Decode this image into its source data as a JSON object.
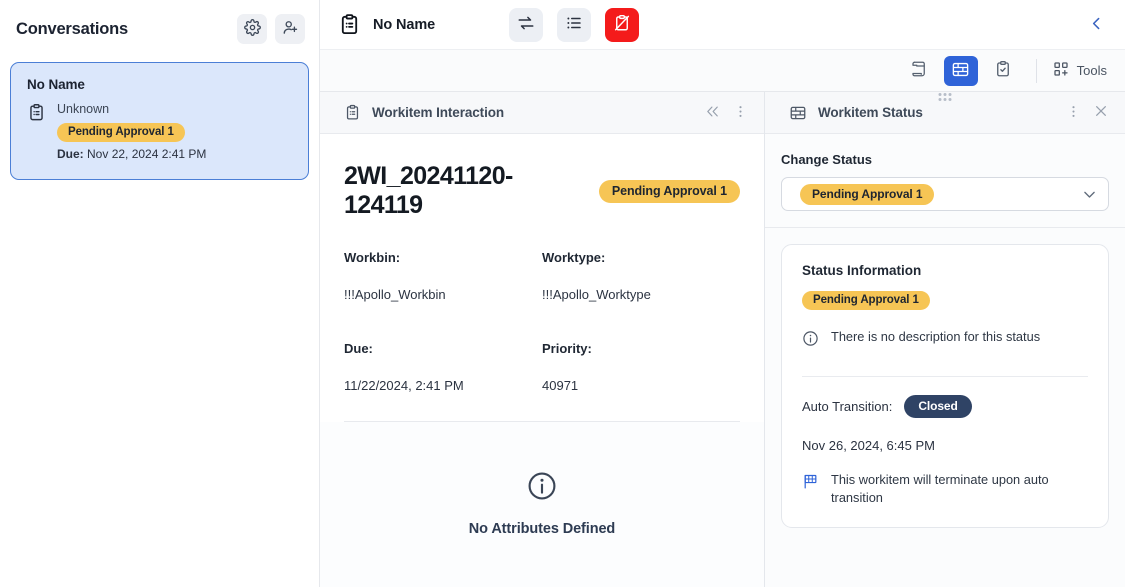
{
  "sidebar": {
    "title": "Conversations",
    "settings_icon": "gear-icon",
    "add_user_icon": "user-plus-icon",
    "conversation": {
      "name": "No Name",
      "channel_icon": "clipboard-list-icon",
      "channel": "Unknown",
      "status_badge": "Pending Approval 1",
      "due_label": "Due:",
      "due_value": "Nov 22, 2024 2:41 PM"
    }
  },
  "topbar": {
    "icon": "clipboard-list-icon",
    "title": "No Name",
    "transfer_icon": "transfer-arrows-icon",
    "list_icon": "list-bullets-icon",
    "cancel_icon": "clipboard-cancel-icon",
    "collapse_icon": "chevron-left-icon"
  },
  "toolsbar": {
    "scroll_icon": "scroll-icon",
    "wall_icon": "wall-brick-icon",
    "clipboard_check_icon": "clipboard-check-icon",
    "tools_icon": "grid-plus-icon",
    "tools_label": "Tools"
  },
  "main_pane": {
    "header_icon": "clipboard-list-icon",
    "header_title": "Workitem Interaction",
    "collapse_icon": "chevrons-left-icon",
    "menu_icon": "kebab-menu-icon",
    "workitem_id": "2WI_20241120-124119",
    "status_badge": "Pending Approval 1",
    "fields": [
      {
        "label": "Workbin:",
        "value": "!!!Apollo_Workbin"
      },
      {
        "label": "Worktype:",
        "value": "!!!Apollo_Worktype"
      },
      {
        "label": "Due:",
        "value": "11/22/2024, 2:41 PM"
      },
      {
        "label": "Priority:",
        "value": "40971"
      }
    ],
    "empty_icon": "info-circle-icon",
    "empty_text": "No Attributes Defined"
  },
  "status_pane": {
    "header_icon": "wall-brick-icon",
    "header_title": "Workitem Status",
    "menu_icon": "kebab-menu-icon",
    "close_icon": "close-x-icon",
    "change_status_label": "Change Status",
    "selected_status": "Pending Approval 1",
    "caret_icon": "chevron-down-icon",
    "card": {
      "title": "Status Information",
      "badge": "Pending Approval 1",
      "description_icon": "info-circle-icon",
      "description": "There is no description for this status",
      "auto_transition_label": "Auto Transition:",
      "auto_transition_value": "Closed",
      "auto_transition_date": "Nov 26, 2024, 6:45 PM",
      "terminate_icon": "flag-grid-icon",
      "terminate_text": "This workitem will terminate upon auto transition"
    }
  },
  "colors": {
    "badge_yellow": "#f6c555",
    "accent_blue": "#2f63d8",
    "danger_red": "#f41b1b",
    "dark_pill": "#2f4365",
    "card_selected_bg": "#dbe7fb",
    "card_selected_border": "#4b7fd6"
  }
}
